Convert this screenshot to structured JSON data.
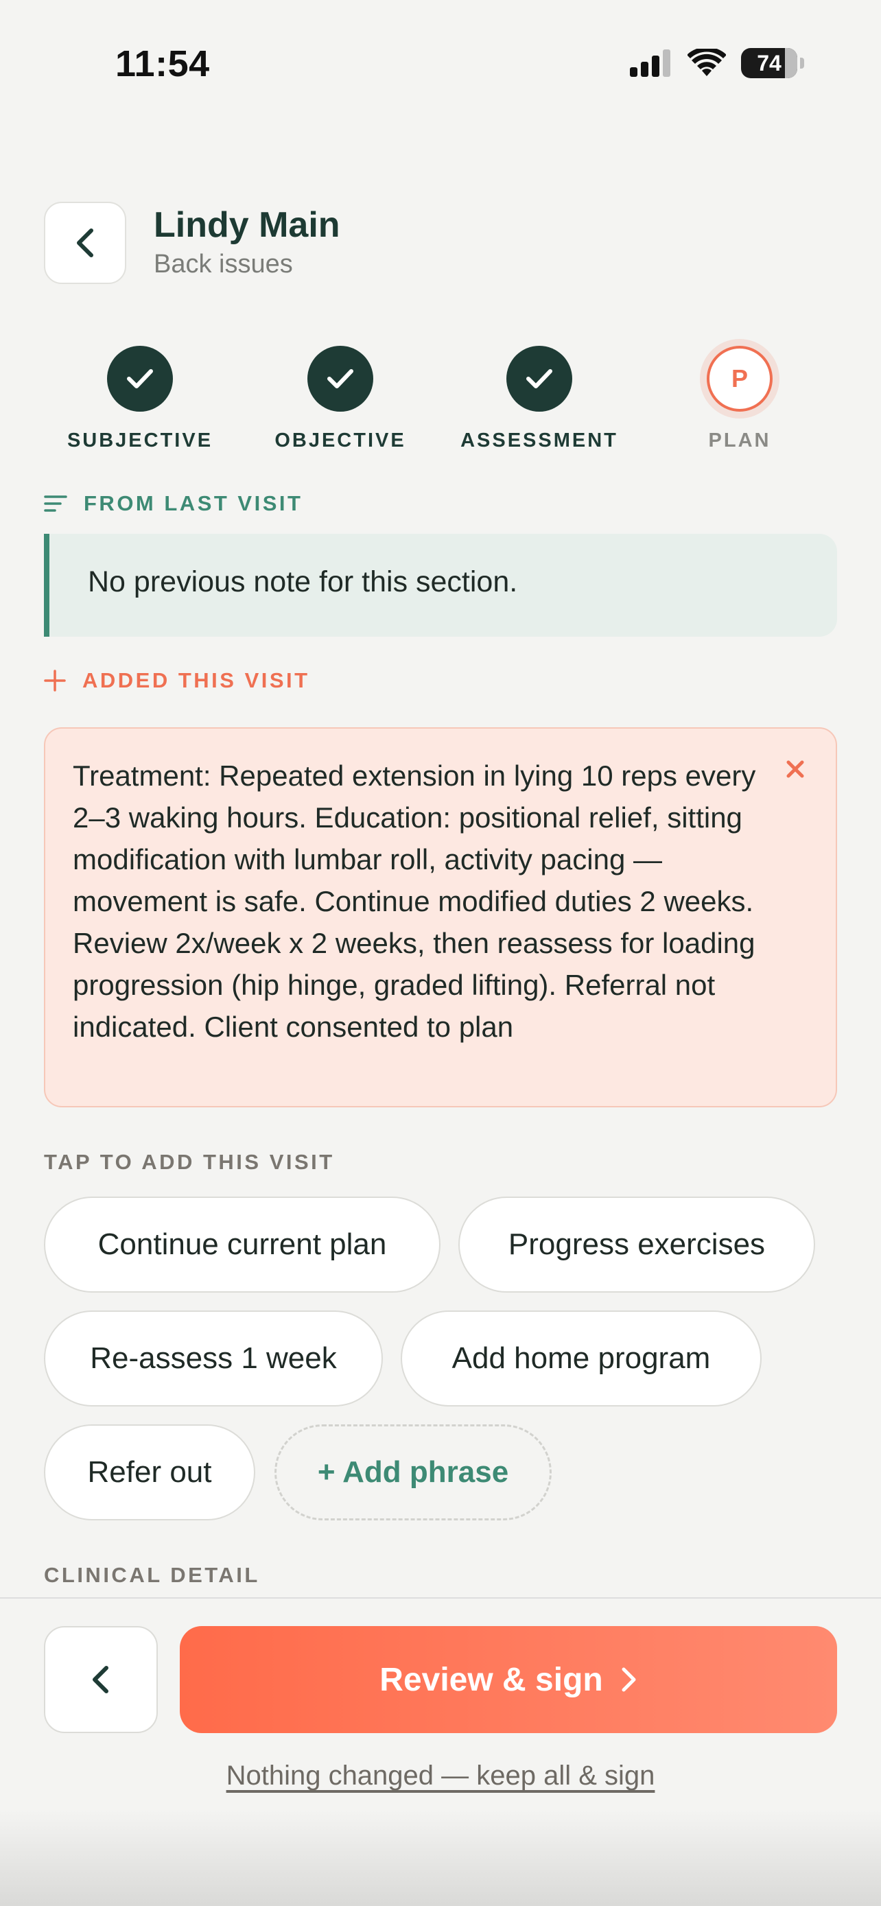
{
  "status_bar": {
    "time": "11:54",
    "battery": "74"
  },
  "header": {
    "patient_name": "Lindy Main",
    "subtitle": "Back issues"
  },
  "steps": [
    {
      "label": "SUBJECTIVE",
      "state": "done"
    },
    {
      "label": "OBJECTIVE",
      "state": "done"
    },
    {
      "label": "ASSESSMENT",
      "state": "done"
    },
    {
      "label": "PLAN",
      "state": "active",
      "letter": "P"
    }
  ],
  "from_last_visit": {
    "label": "FROM LAST VISIT",
    "text": "No previous note for this section."
  },
  "added_this_visit": {
    "label": "ADDED THIS VISIT",
    "text": "Treatment: Repeated extension in lying 10 reps every 2–3 waking hours. Education: positional relief, sitting modification with lumbar roll, activity pacing — movement is safe. Continue modified duties 2 weeks. Review 2x/week x 2 weeks, then reassess for loading progression (hip hinge, graded lifting). Referral not indicated. Client consented to plan"
  },
  "tap_to_add": {
    "label": "TAP TO ADD THIS VISIT",
    "chips": [
      "Continue current plan",
      "Progress exercises",
      "Re-assess 1 week",
      "Add home program",
      "Refer out"
    ],
    "add_phrase": "+ Add phrase"
  },
  "clinical_detail_label": "CLINICAL DETAIL",
  "footer": {
    "primary_label": "Review & sign",
    "keep_link": "Nothing changed — keep all & sign"
  },
  "colors": {
    "primary_dark": "#1e3b35",
    "accent_green": "#3d8a74",
    "accent_coral": "#ef7052"
  }
}
